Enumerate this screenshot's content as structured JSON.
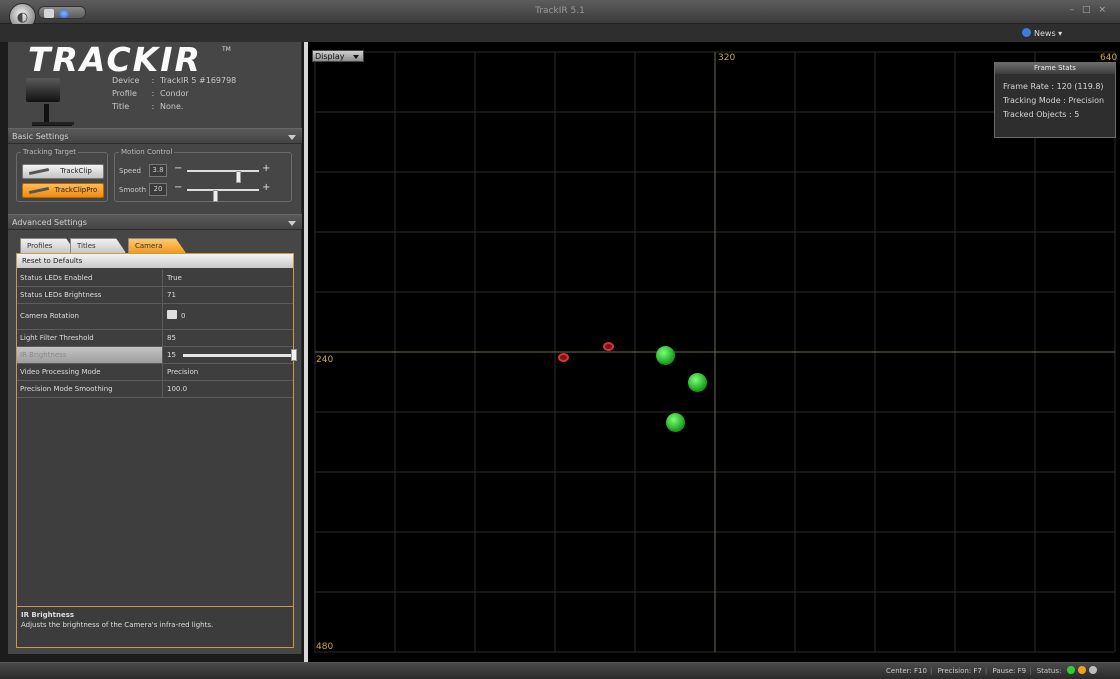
{
  "window": {
    "title": "TrackIR 5.1"
  },
  "news": {
    "label": "News"
  },
  "logo": {
    "text": "TRACKIR",
    "tm": "TM"
  },
  "device_info": {
    "device_label": "Device",
    "device_value": "TrackIR 5 #169798",
    "profile_label": "Profile",
    "profile_value": "Condor",
    "title_label": "Title",
    "title_value": "None.",
    "separator": ":"
  },
  "basic_settings": {
    "header": "Basic Settings",
    "tracking_target": {
      "legend": "Tracking Target",
      "trackclip": "TrackClip",
      "trackclippro": "TrackClipPro"
    },
    "motion_control": {
      "legend": "Motion Control",
      "speed_label": "Speed",
      "speed_value": "3.8",
      "speed_level": 0.72,
      "smooth_label": "Smooth",
      "smooth_value": "20",
      "smooth_level": 0.4,
      "minus": "−",
      "plus": "+"
    }
  },
  "advanced_settings": {
    "header": "Advanced Settings",
    "tabs": [
      {
        "label": "Profiles"
      },
      {
        "label": "Titles"
      },
      {
        "label": "Camera"
      }
    ],
    "reset_label": "Reset to Defaults",
    "properties": [
      {
        "name": "Status LEDs Enabled",
        "value": "True"
      },
      {
        "name": "Status LEDs Brightness",
        "value": "71"
      },
      {
        "name": "Camera Rotation",
        "value": "0"
      },
      {
        "name": "Light Filter Threshold",
        "value": "85"
      },
      {
        "name": "IR Brightness",
        "value": "15"
      },
      {
        "name": "Video Processing Mode",
        "value": "Precision"
      },
      {
        "name": "Precision Mode Smoothing",
        "value": "100.0"
      }
    ],
    "help": {
      "title": "IR Brightness",
      "text": "Adjusts the brightness of the Camera's infra-red lights."
    }
  },
  "camera_view": {
    "display_label": "Display",
    "axis": {
      "x_mid": "320",
      "x_max": "640",
      "y_mid": "240",
      "y_max": "480"
    },
    "frame_stats": {
      "title": "Frame Stats",
      "frame_rate": "Frame Rate : 120 (119.8)",
      "tracking_mode": "Tracking Mode : Precision",
      "tracked_objects": "Tracked Objects : 5"
    }
  },
  "statusbar": {
    "center": "Center: F10",
    "precision": "Precision: F7",
    "pause": "Pause: F9",
    "status": "Status:",
    "colors": {
      "green": "#2fd12f",
      "orange": "#f2a21a",
      "gray": "#bdbdbd"
    }
  }
}
